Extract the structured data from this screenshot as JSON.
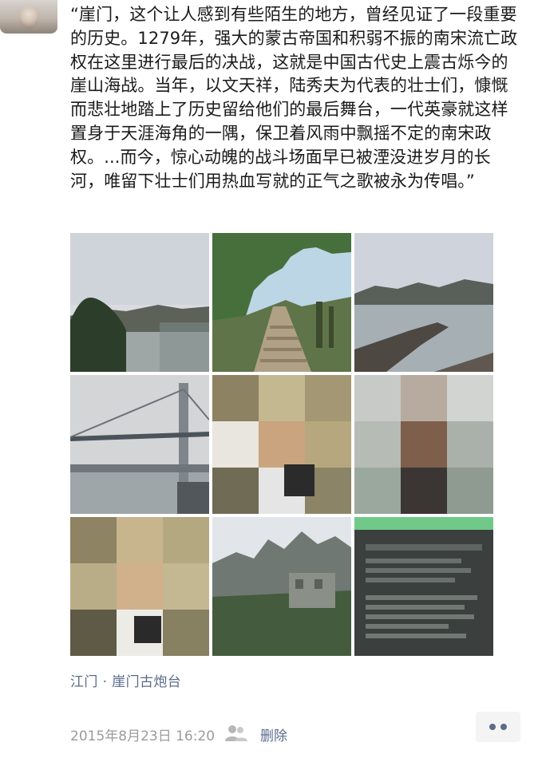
{
  "post": {
    "text": "“崖门，这个让人感到有些陌生的地方，曾经见证了一段重要的历史。1279年，强大的蒙古帝国和积弱不振的南宋流亡政权在这里进行最后的决战，这就是中国古代史上震古烁今的崖山海战。当年，以文天祥，陆秀夫为代表的壮士们，慷慨而悲壮地踏上了历史留给他们的最后舞台，一代英豪就这样置身于天涯海角的一隅，保卫着风雨中飘摇不定的南宋政权。...而今，惊心动魄的战斗场面早已被湮没进岁月的长河，唯留下壮士们用热血写就的正气之歌被永为传唱。”",
    "photos": [
      {
        "name": "photo-coastal-hills-tree"
      },
      {
        "name": "photo-stone-stairway-trees"
      },
      {
        "name": "photo-river-hills-pier"
      },
      {
        "name": "photo-bridge-over-river"
      },
      {
        "name": "photo-person-pixelated"
      },
      {
        "name": "photo-person-posing-pixelated"
      },
      {
        "name": "photo-person-portrait-pixelated"
      },
      {
        "name": "photo-fortress-ruins"
      },
      {
        "name": "photo-info-sign"
      }
    ],
    "location": "江门 · 崖门古炮台",
    "timestamp": "2015年8月23日 16:20",
    "delete_label": "删除"
  },
  "icons": {
    "visibility": "friends-visibility-icon",
    "more": "more-dots-icon"
  },
  "colors": {
    "link": "#5b6b8c",
    "meta": "#9b9b9b",
    "text": "#1a1a1a",
    "more_bg": "#f4f4f4"
  }
}
